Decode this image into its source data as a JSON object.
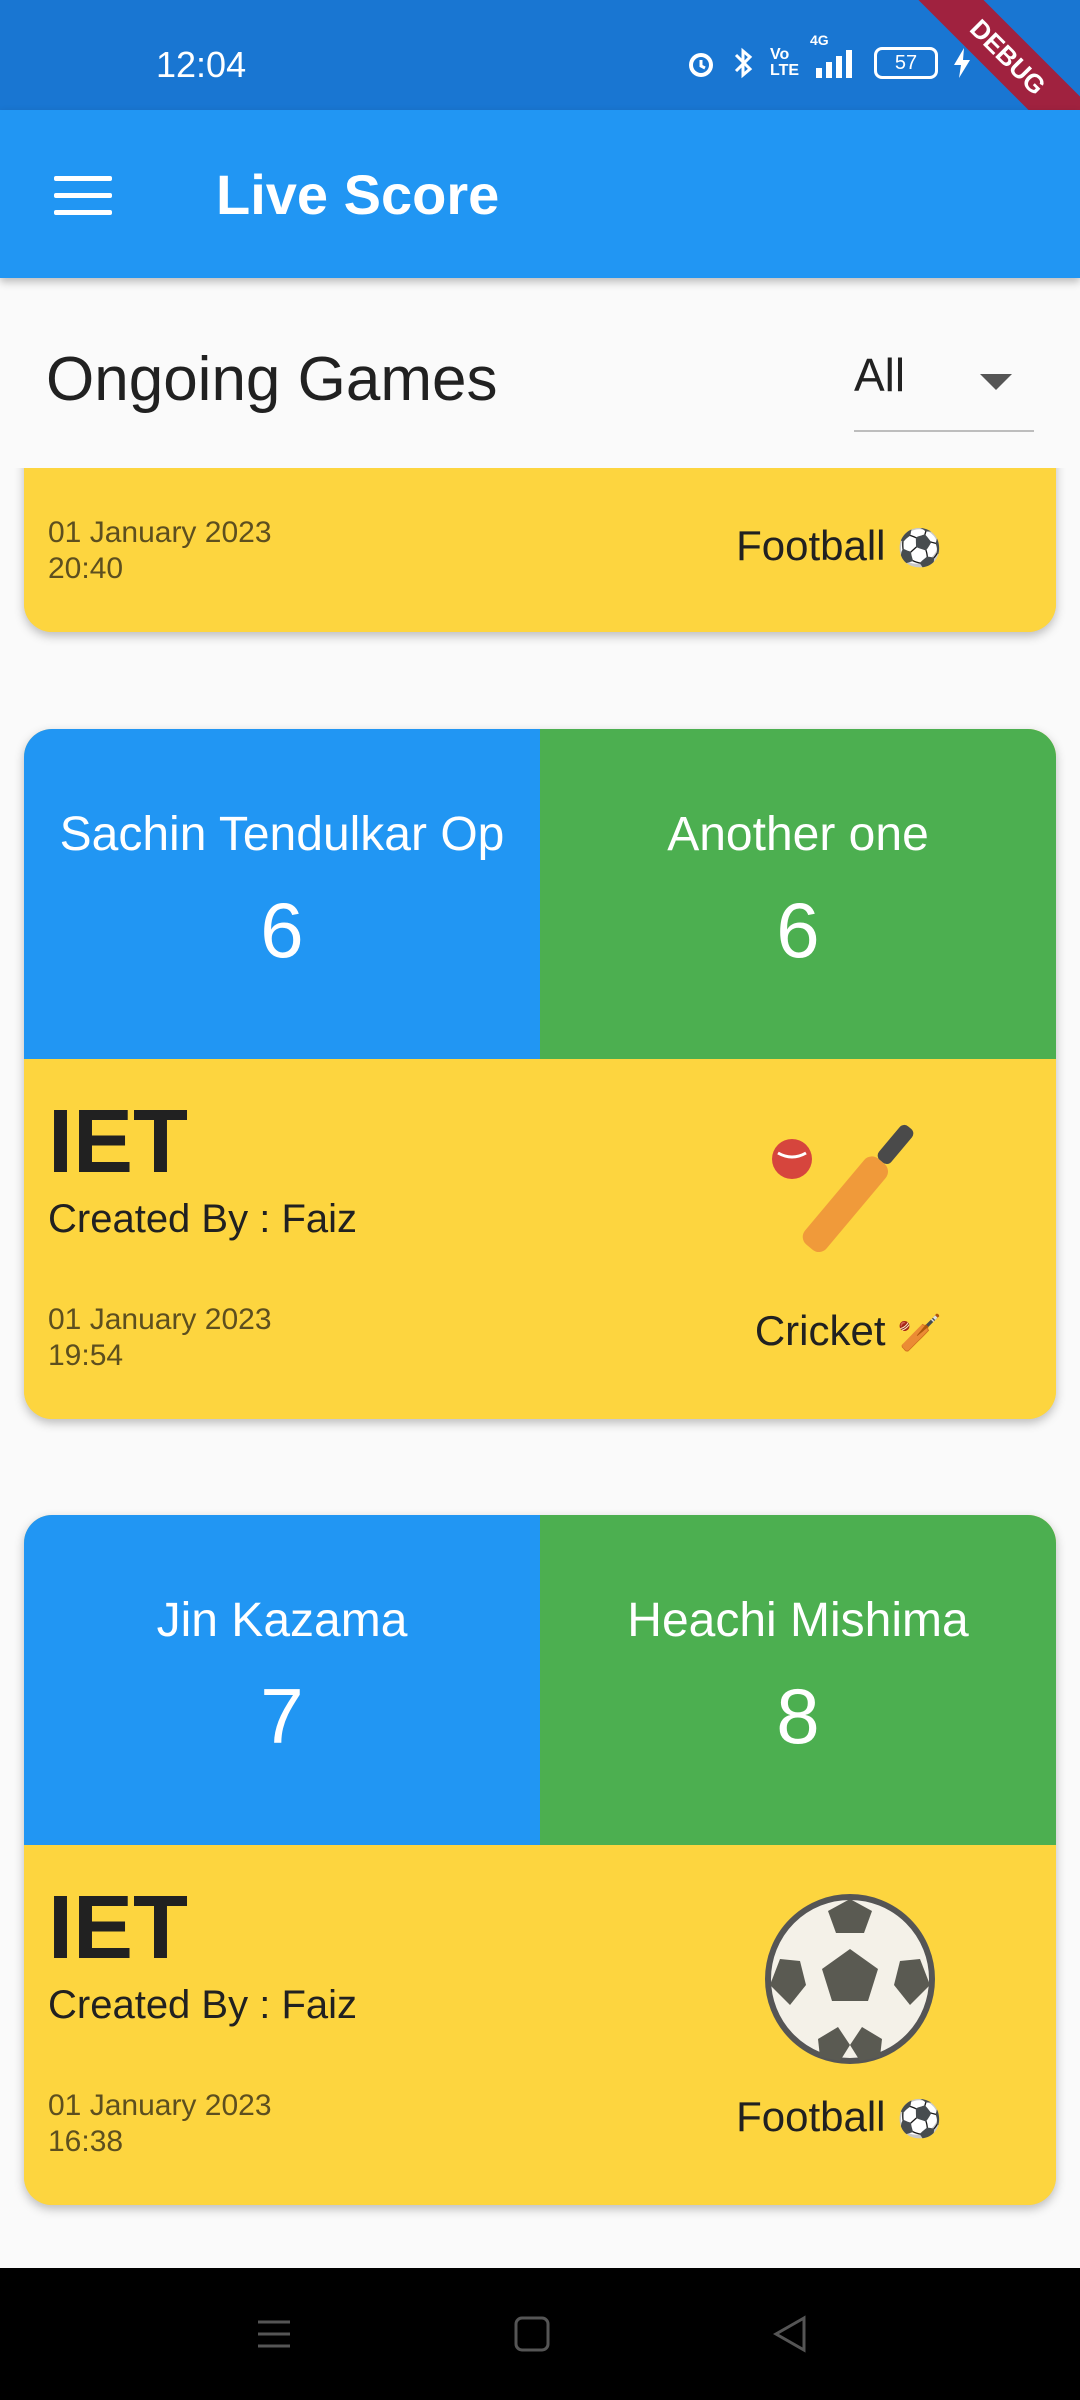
{
  "status_bar": {
    "time": "12:04",
    "battery": "57",
    "signal": "4G",
    "volte": "Vo LTE",
    "debug_label": "DEBUG"
  },
  "app_bar": {
    "title": "Live Score"
  },
  "header": {
    "title": "Ongoing Games",
    "filter_value": "All"
  },
  "partial_card": {
    "date": "01 January 2023",
    "time": "20:40",
    "sport": "Football",
    "sport_emoji": "⚽"
  },
  "cards": [
    {
      "team_a": {
        "name": "Sachin Tendulkar Op",
        "score": "6"
      },
      "team_b": {
        "name": "Another one",
        "score": "6"
      },
      "game": "IET",
      "created_by": "Created By : Faiz",
      "date": "01 January 2023",
      "time": "19:54",
      "sport": "Cricket",
      "sport_emoji": "🏏",
      "icon": "cricket-bat-ball-icon"
    },
    {
      "team_a": {
        "name": "Jin Kazama",
        "score": "7"
      },
      "team_b": {
        "name": "Heachi Mishima",
        "score": "8"
      },
      "game": "IET",
      "created_by": "Created By : Faiz",
      "date": "01 January 2023",
      "time": "16:38",
      "sport": "Football",
      "sport_emoji": "⚽",
      "icon": "football-icon"
    }
  ],
  "colors": {
    "primary": "#2196f3",
    "status": "#1976d2",
    "team_b": "#4caf50",
    "card": "#fdd53f"
  }
}
